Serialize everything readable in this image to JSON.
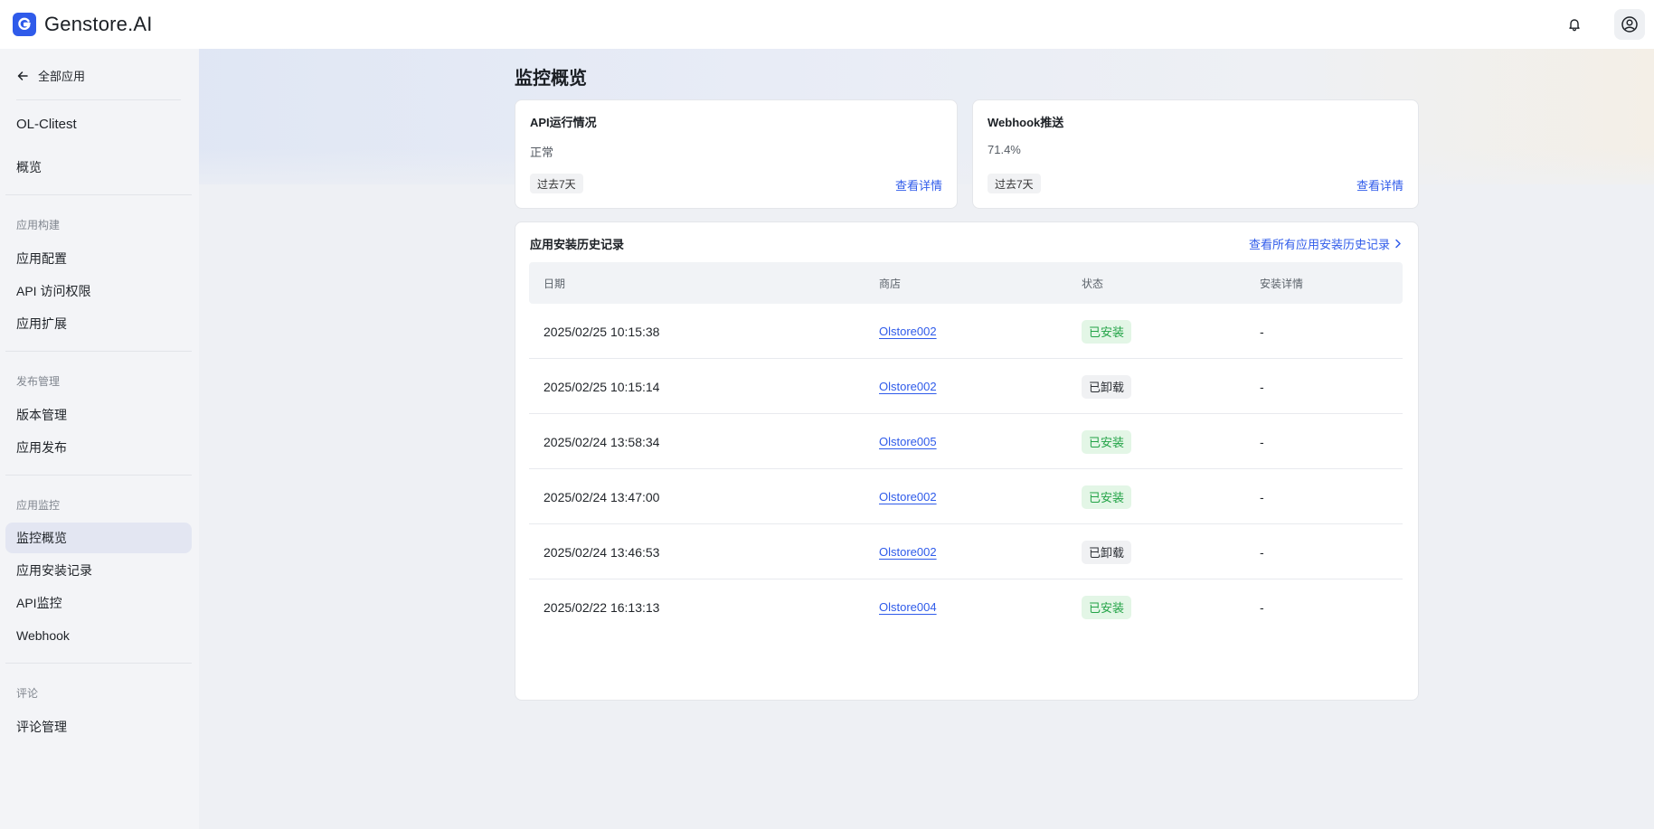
{
  "header": {
    "brand": "Genstore.AI",
    "icons": {
      "logo": "genstore-logo-icon",
      "notifications": "bell-icon",
      "account": "user-circle-icon"
    },
    "accent": "#2f5bea"
  },
  "sidebar": {
    "back_label": "全部应用",
    "app_name": "OL-Clitest",
    "overview": "概览",
    "groups": [
      {
        "title": "应用构建",
        "items": [
          "应用配置",
          "API 访问权限",
          "应用扩展"
        ]
      },
      {
        "title": "发布管理",
        "items": [
          "版本管理",
          "应用发布"
        ]
      },
      {
        "title": "应用监控",
        "items": [
          "监控概览",
          "应用安装记录",
          "API监控",
          "Webhook"
        ]
      },
      {
        "title": "评论",
        "items": [
          "评论管理"
        ]
      }
    ],
    "active_item": "监控概览"
  },
  "main": {
    "title": "监控概览",
    "cards": [
      {
        "title": "API运行情况",
        "value": "正常",
        "period": "过去7天",
        "link": "查看详情"
      },
      {
        "title": "Webhook推送",
        "value": "71.4%",
        "period": "过去7天",
        "link": "查看详情"
      }
    ],
    "history": {
      "title": "应用安装历史记录",
      "view_all": "查看所有应用安装历史记录",
      "columns": [
        "日期",
        "商店",
        "状态",
        "安装详情"
      ],
      "rows": [
        {
          "date": "2025/02/25 10:15:38",
          "store": "Olstore002",
          "status": "已安装",
          "status_type": "installed",
          "detail": "-"
        },
        {
          "date": "2025/02/25 10:15:14",
          "store": "Olstore002",
          "status": "已卸载",
          "status_type": "uninstalled",
          "detail": "-"
        },
        {
          "date": "2025/02/24 13:58:34",
          "store": "Olstore005",
          "status": "已安装",
          "status_type": "installed",
          "detail": "-"
        },
        {
          "date": "2025/02/24 13:47:00",
          "store": "Olstore002",
          "status": "已安装",
          "status_type": "installed",
          "detail": "-"
        },
        {
          "date": "2025/02/24 13:46:53",
          "store": "Olstore002",
          "status": "已卸载",
          "status_type": "uninstalled",
          "detail": "-"
        },
        {
          "date": "2025/02/22 16:13:13",
          "store": "Olstore004",
          "status": "已安装",
          "status_type": "installed",
          "detail": "-"
        }
      ]
    }
  },
  "colors": {
    "installed": "#23a347",
    "uninstalled": "#2b2f34",
    "link": "#2f5bea"
  }
}
